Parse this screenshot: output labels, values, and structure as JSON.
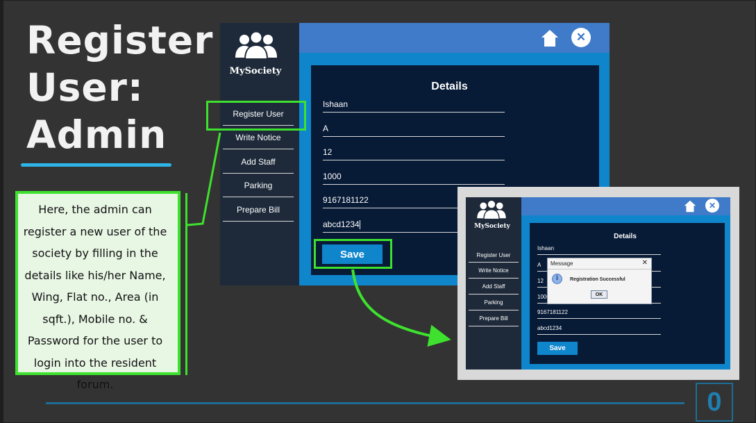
{
  "slide": {
    "title_lines": [
      "Register",
      "User:",
      "Admin"
    ],
    "description": "Here, the admin can register a new user of the society by filling in the details like his/her Name, Wing, Flat no., Area (in sqft.), Mobile no. & Password for the user to login into the resident forum.",
    "page_number": "0"
  },
  "app": {
    "brand": "MySociety",
    "nav": [
      "Register User",
      "Write Notice",
      "Add Staff",
      "Parking",
      "Prepare Bill"
    ],
    "details_title": "Details",
    "fields": [
      "Ishaan",
      "A",
      "12",
      "1000",
      "9167181122",
      "abcd1234"
    ],
    "save_label": "Save"
  },
  "dialog": {
    "title": "Message",
    "close": "✕",
    "message": "Registration Successful",
    "ok_label": "OK",
    "icon": "info-icon"
  },
  "colors": {
    "background": "#333333",
    "accent_green": "#3ee22e",
    "title_blue_bar": "#3f7bc8",
    "panel": "#071a36",
    "button": "#0f86cc"
  }
}
